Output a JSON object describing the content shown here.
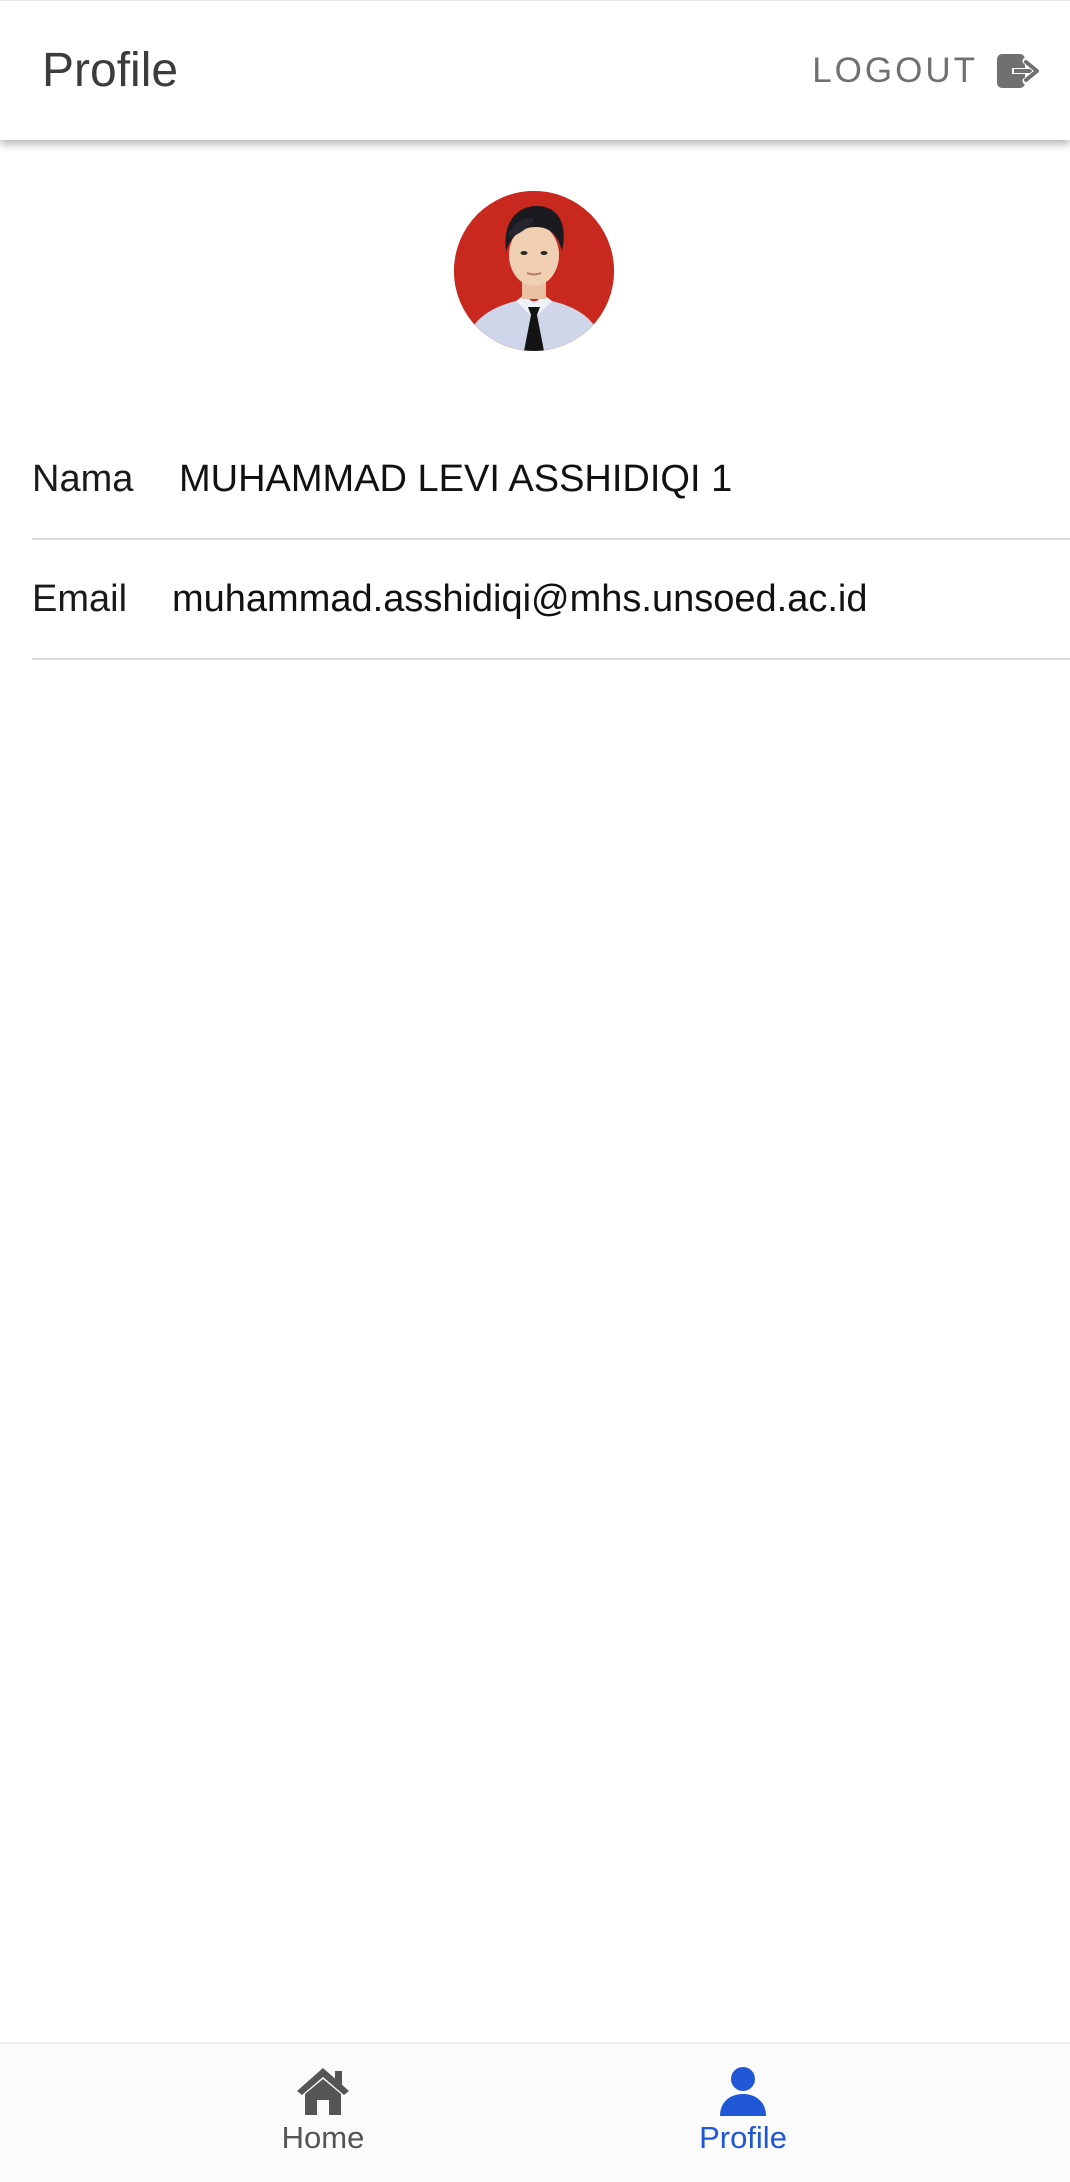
{
  "header": {
    "title": "Profile",
    "logout_label": "LOGOUT",
    "logout_icon": "logout-icon"
  },
  "profile": {
    "avatar_icon": "profile-photo",
    "fields": [
      {
        "label": "Nama",
        "value": "MUHAMMAD LEVI ASSHIDIQI 1"
      },
      {
        "label": "Email",
        "value": "muhammad.asshidiqi@mhs.unsoed.ac.id"
      }
    ]
  },
  "bottom_nav": {
    "items": [
      {
        "label": "Home",
        "icon": "home-icon",
        "active": false
      },
      {
        "label": "Profile",
        "icon": "person-icon",
        "active": true
      }
    ],
    "active_color": "#1f57d6",
    "inactive_color": "#555555"
  },
  "colors": {
    "avatar_background": "#c9281e"
  }
}
